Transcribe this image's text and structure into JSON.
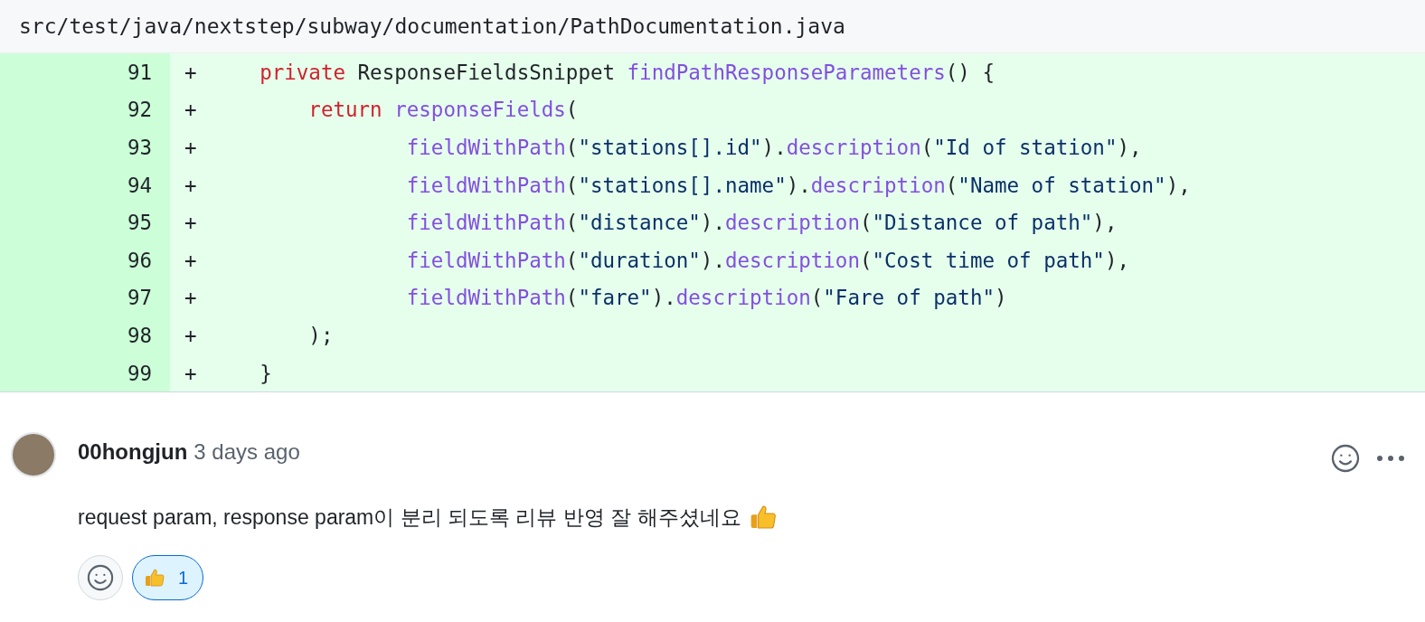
{
  "file_header": {
    "path": "src/test/java/nextstep/subway/documentation/PathDocumentation.java"
  },
  "diff_lines": [
    {
      "number": "91",
      "sign": "+",
      "tokens": [
        {
          "kind": "keyword",
          "text": "    private"
        },
        {
          "kind": "plain",
          "text": " ResponseFieldsSnippet "
        },
        {
          "kind": "function",
          "text": "findPathResponseParameters"
        },
        {
          "kind": "plain",
          "text": "() {"
        }
      ]
    },
    {
      "number": "92",
      "sign": "+",
      "tokens": [
        {
          "kind": "keyword",
          "text": "        return"
        },
        {
          "kind": "function",
          "text": " responseFields"
        },
        {
          "kind": "plain",
          "text": "("
        }
      ]
    },
    {
      "number": "93",
      "sign": "+",
      "tokens": [
        {
          "kind": "function",
          "text": "                fieldWithPath"
        },
        {
          "kind": "plain",
          "text": "("
        },
        {
          "kind": "string",
          "text": "\"stations[].id\""
        },
        {
          "kind": "plain",
          "text": ")."
        },
        {
          "kind": "function",
          "text": "description"
        },
        {
          "kind": "plain",
          "text": "("
        },
        {
          "kind": "string",
          "text": "\"Id of station\""
        },
        {
          "kind": "plain",
          "text": "),"
        }
      ]
    },
    {
      "number": "94",
      "sign": "+",
      "tokens": [
        {
          "kind": "function",
          "text": "                fieldWithPath"
        },
        {
          "kind": "plain",
          "text": "("
        },
        {
          "kind": "string",
          "text": "\"stations[].name\""
        },
        {
          "kind": "plain",
          "text": ")."
        },
        {
          "kind": "function",
          "text": "description"
        },
        {
          "kind": "plain",
          "text": "("
        },
        {
          "kind": "string",
          "text": "\"Name of station\""
        },
        {
          "kind": "plain",
          "text": "),"
        }
      ]
    },
    {
      "number": "95",
      "sign": "+",
      "tokens": [
        {
          "kind": "function",
          "text": "                fieldWithPath"
        },
        {
          "kind": "plain",
          "text": "("
        },
        {
          "kind": "string",
          "text": "\"distance\""
        },
        {
          "kind": "plain",
          "text": ")."
        },
        {
          "kind": "function",
          "text": "description"
        },
        {
          "kind": "plain",
          "text": "("
        },
        {
          "kind": "string",
          "text": "\"Distance of path\""
        },
        {
          "kind": "plain",
          "text": "),"
        }
      ]
    },
    {
      "number": "96",
      "sign": "+",
      "tokens": [
        {
          "kind": "function",
          "text": "                fieldWithPath"
        },
        {
          "kind": "plain",
          "text": "("
        },
        {
          "kind": "string",
          "text": "\"duration\""
        },
        {
          "kind": "plain",
          "text": ")."
        },
        {
          "kind": "function",
          "text": "description"
        },
        {
          "kind": "plain",
          "text": "("
        },
        {
          "kind": "string",
          "text": "\"Cost time of path\""
        },
        {
          "kind": "plain",
          "text": "),"
        }
      ]
    },
    {
      "number": "97",
      "sign": "+",
      "tokens": [
        {
          "kind": "function",
          "text": "                fieldWithPath"
        },
        {
          "kind": "plain",
          "text": "("
        },
        {
          "kind": "string",
          "text": "\"fare\""
        },
        {
          "kind": "plain",
          "text": ")."
        },
        {
          "kind": "function",
          "text": "description"
        },
        {
          "kind": "plain",
          "text": "("
        },
        {
          "kind": "string",
          "text": "\"Fare of path\""
        },
        {
          "kind": "plain",
          "text": ")"
        }
      ]
    },
    {
      "number": "98",
      "sign": "+",
      "tokens": [
        {
          "kind": "plain",
          "text": "        );"
        }
      ]
    },
    {
      "number": "99",
      "sign": "+",
      "tokens": [
        {
          "kind": "plain",
          "text": "    }"
        }
      ]
    }
  ],
  "comment": {
    "author": "00hongjun",
    "time": "3 days ago",
    "body": "request param, response param이 분리 되도록 리뷰 반영 잘 해주셨네요",
    "reactions": [
      {
        "count": "1",
        "selected": true
      }
    ]
  }
}
